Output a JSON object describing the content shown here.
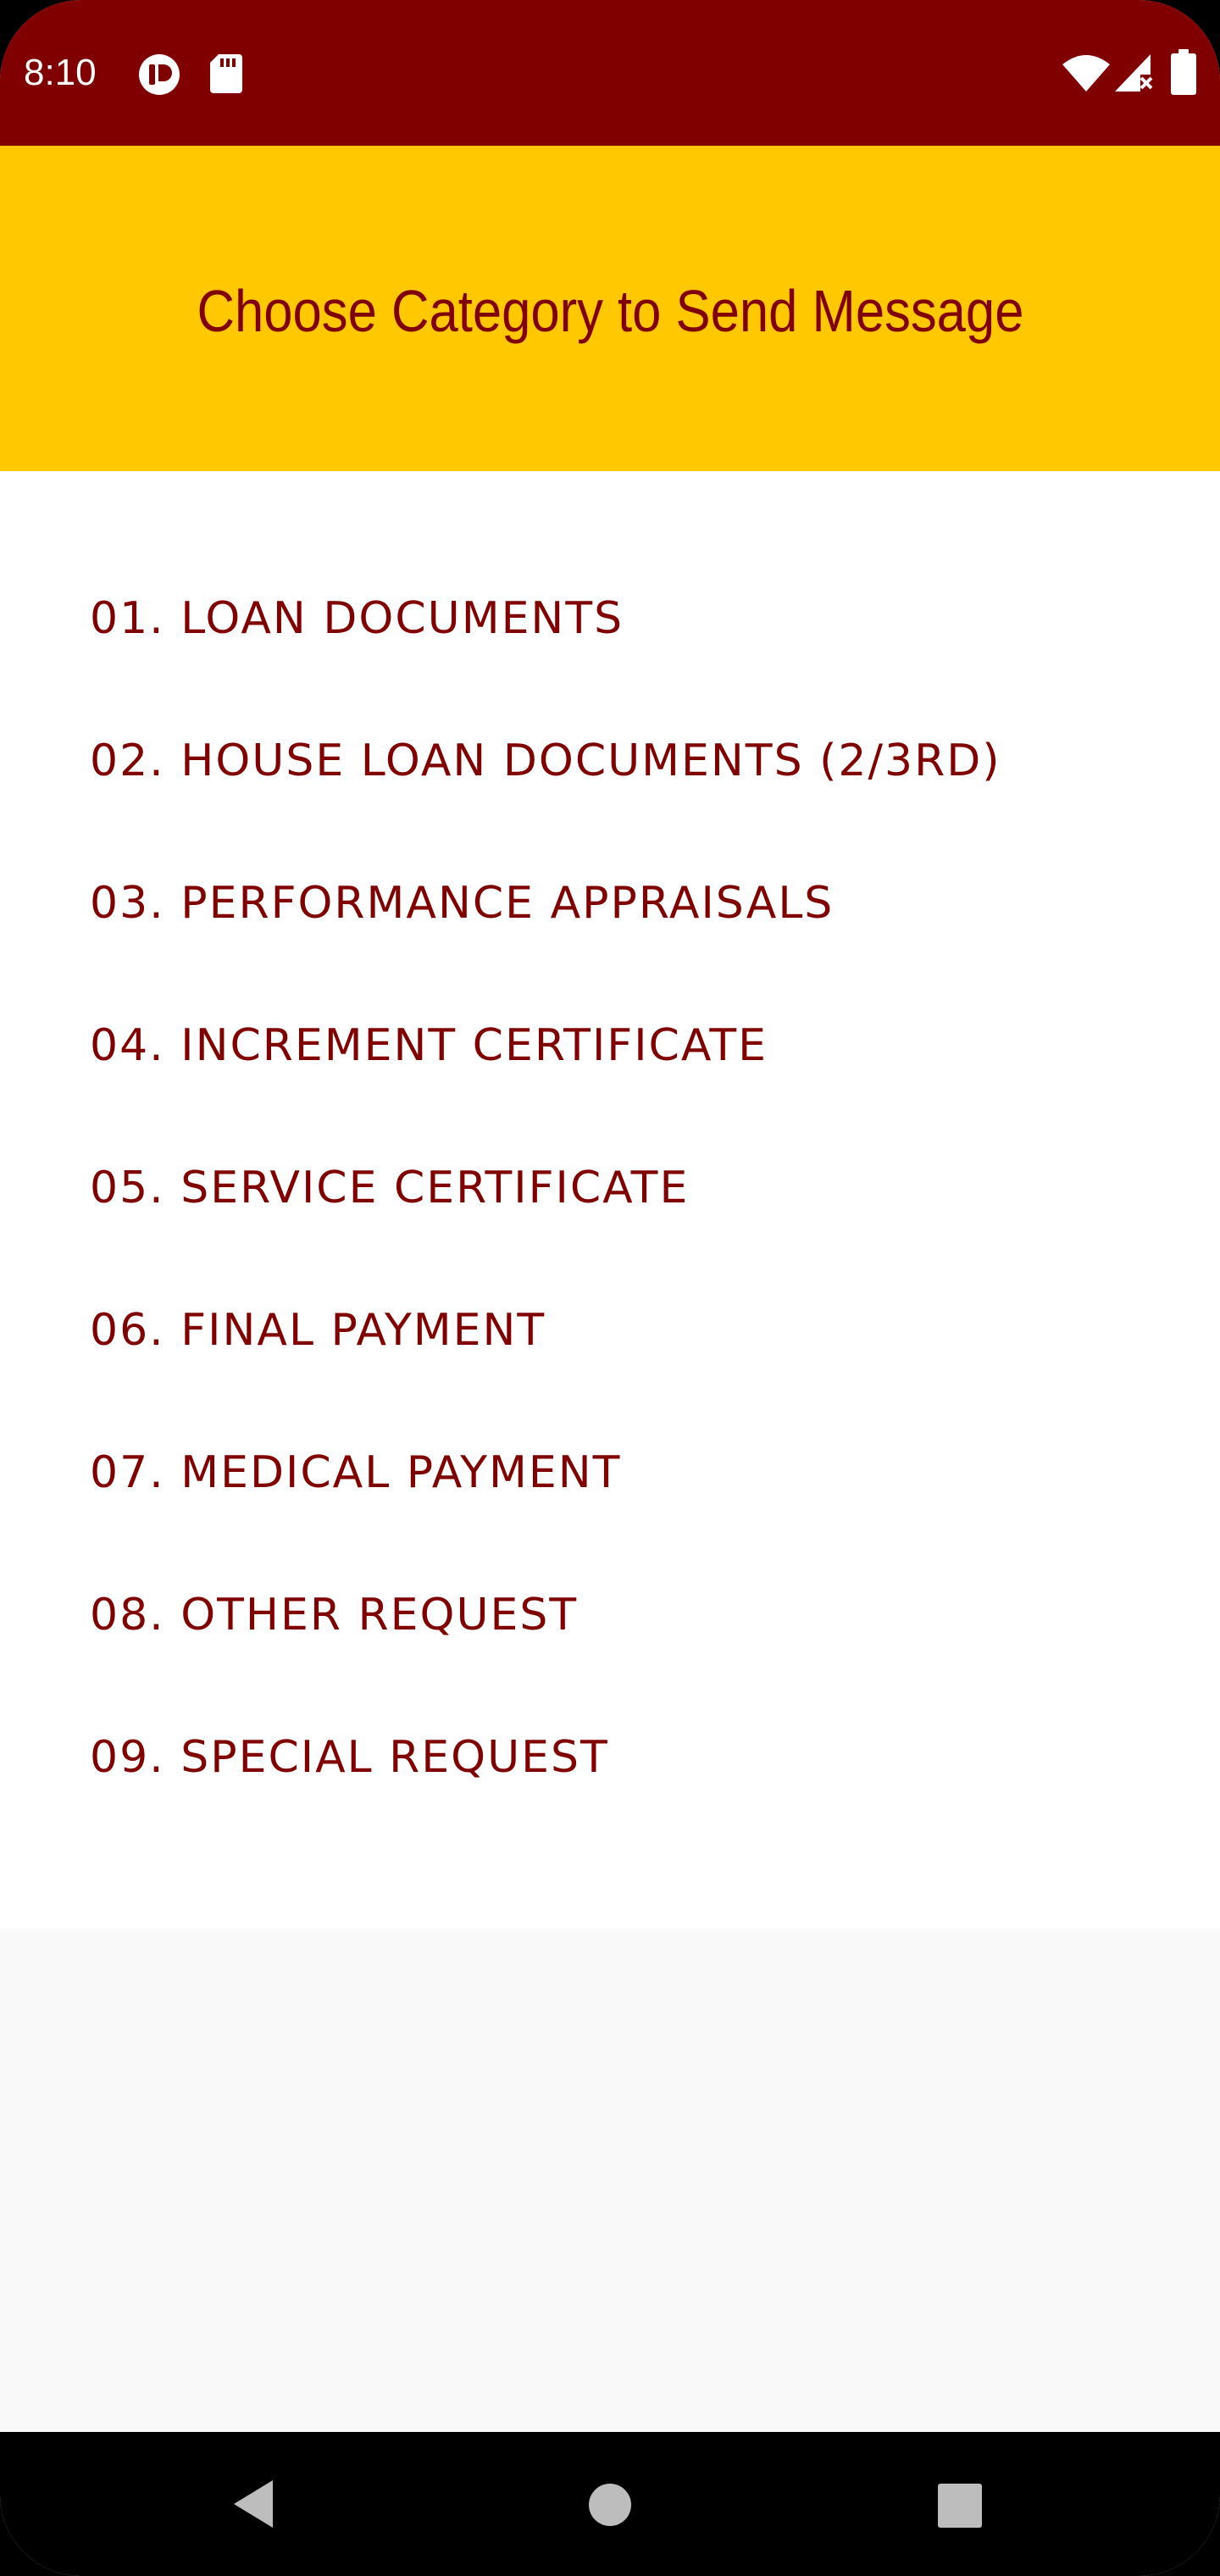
{
  "status_bar": {
    "time": "8:10",
    "background_color": "#800000",
    "icons": [
      "app-notification-icon",
      "sd-card-icon",
      "wifi-icon",
      "cellular-signal-icon",
      "battery-icon"
    ]
  },
  "header": {
    "title": "Choose Category to Send Message",
    "background_color": "#ffc800",
    "text_color": "#800000"
  },
  "categories": [
    {
      "label": "01. LOAN DOCUMENTS"
    },
    {
      "label": "02. HOUSE LOAN DOCUMENTS (2/3RD)"
    },
    {
      "label": "03. PERFORMANCE APPRAISALS"
    },
    {
      "label": "04. INCREMENT CERTIFICATE"
    },
    {
      "label": "05. SERVICE CERTIFICATE"
    },
    {
      "label": "06. FINAL PAYMENT"
    },
    {
      "label": "07. MEDICAL PAYMENT"
    },
    {
      "label": "08. OTHER REQUEST"
    },
    {
      "label": "09. SPECIAL REQUEST"
    }
  ],
  "category_text_color": "#800000",
  "nav_bar": {
    "buttons": [
      "back-icon",
      "home-icon",
      "recents-icon"
    ]
  }
}
